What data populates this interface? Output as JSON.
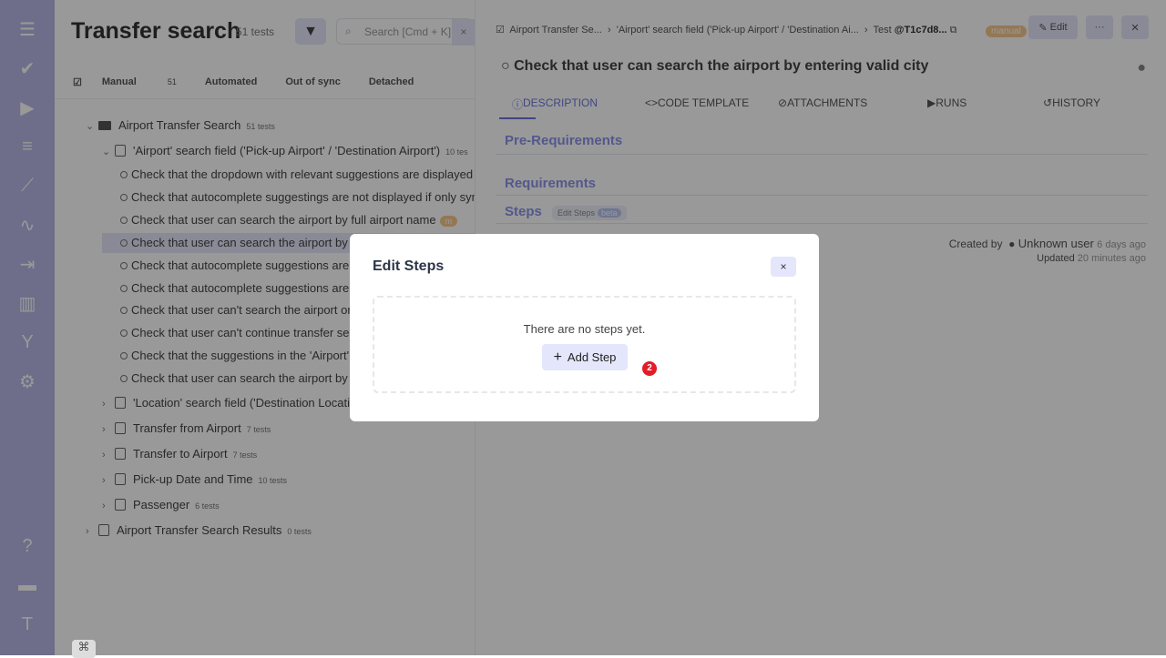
{
  "sidebar": {
    "items": [
      {
        "icon": "menu-icon",
        "glyph": "☰"
      },
      {
        "icon": "check-icon",
        "glyph": "✔"
      },
      {
        "icon": "play-icon",
        "glyph": "▶"
      },
      {
        "icon": "checklist-icon",
        "glyph": "≡"
      },
      {
        "icon": "stairs-icon",
        "glyph": "⟋"
      },
      {
        "icon": "pulse-icon",
        "glyph": "∿"
      },
      {
        "icon": "import-icon",
        "glyph": "⇥"
      },
      {
        "icon": "chart-icon",
        "glyph": "▥"
      },
      {
        "icon": "branch-icon",
        "glyph": "Y"
      },
      {
        "icon": "gear-icon",
        "glyph": "⚙"
      }
    ],
    "bottom": [
      {
        "icon": "help-icon",
        "glyph": "?"
      },
      {
        "icon": "folder-icon",
        "glyph": "▬"
      },
      {
        "icon": "avatar-icon",
        "glyph": "T"
      }
    ]
  },
  "left": {
    "title": "Transfer search",
    "count": "51 tests",
    "search_placeholder": "Search [Cmd + K]",
    "tabs": [
      {
        "label": "Manual",
        "count": "51"
      },
      {
        "label": "Automated",
        "count": ""
      },
      {
        "label": "Out of sync",
        "count": ""
      },
      {
        "label": "Detached",
        "count": ""
      }
    ],
    "tree": {
      "root": {
        "label": "Airport Transfer Search",
        "count": "51 tests"
      },
      "suite": {
        "label": "'Airport' search field ('Pick-up Airport' / 'Destination Airport')",
        "count": "10 tes"
      },
      "tests": [
        "Check that the dropdown with relevant suggestions are displayed i",
        "Check that autocomplete suggestings are not displayed if only sym",
        "Check that user can search the airport by full airport name",
        "Check that user can search the airport by e",
        "Check that autocomplete suggestions are c",
        "Check that autocomplete suggestions are c",
        "Check that user can't search the airport on",
        "Check that user can't continue transfer sea",
        "Check that the suggestions in the 'Airport' s",
        "Check that user can search the airport by s"
      ],
      "test_badge": "m",
      "suites": [
        {
          "label": "'Location' search field ('Destination Locatio",
          "count": ""
        },
        {
          "label": "Transfer from Airport",
          "count": "7 tests"
        },
        {
          "label": "Transfer to Airport",
          "count": "7 tests"
        },
        {
          "label": "Pick-up Date and Time",
          "count": "10 tests"
        },
        {
          "label": "Passenger",
          "count": "6 tests"
        }
      ],
      "root2": {
        "label": "Airport Transfer Search Results",
        "count": "0 tests"
      }
    },
    "shortcut": "⌘"
  },
  "right": {
    "breadcrumb": [
      "Airport Transfer Se...",
      "'Airport' search field ('Pick-up Airport' / 'Destination Ai...",
      "Test"
    ],
    "test_id": "@T1c7d8...",
    "type_badge": "manual",
    "edit_label": "Edit",
    "more_label": "···",
    "close_label": "×",
    "title": "Check that user can search the airport by entering valid city",
    "tabs": [
      "DESCRIPTION",
      "CODE TEMPLATE",
      "ATTACHMENTS",
      "RUNS",
      "HISTORY"
    ],
    "sections": {
      "pre": "Pre-Requirements",
      "req": "Requirements",
      "steps": "Steps",
      "edit_steps": "Edit Steps",
      "beta": "beta"
    },
    "meta": {
      "created_label": "Created by",
      "user": "Unknown user",
      "created_ago": "6 days ago",
      "updated_label": "Updated",
      "updated_ago": "20 minutes ago"
    }
  },
  "modal": {
    "title": "Edit Steps",
    "close": "×",
    "empty": "There are no steps yet.",
    "add_label": "Add Step",
    "badge": "2"
  }
}
